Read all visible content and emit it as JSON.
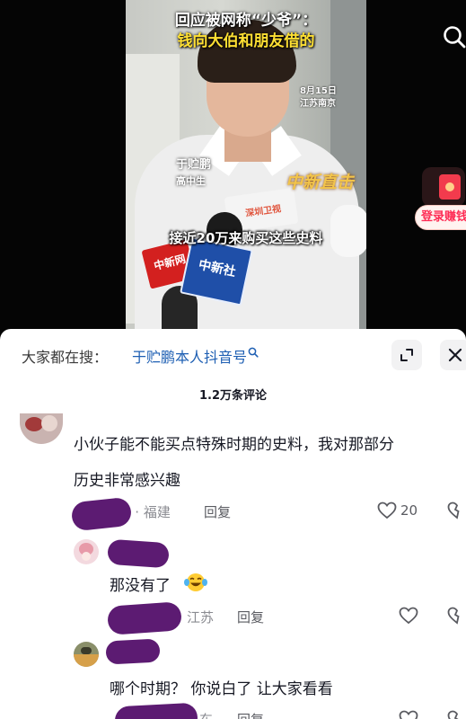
{
  "video": {
    "title_line1": "回应被网称“少爷”：",
    "title_line2": "钱向大伯和朋友借的",
    "date": "8月15日",
    "location": "江苏南京",
    "person_name": "于贮鹏",
    "person_role": "高中生",
    "brand_watermark": "中新直击",
    "subtitle": "接近20万来购买这些史料",
    "mic_red_text": "中新网",
    "mic_blue_text": "中新社",
    "mic_white_text": "深圳卫视"
  },
  "promo": {
    "label": "登录赚钱"
  },
  "comments_panel": {
    "search_prefix": "大家都在搜：",
    "search_term": "于贮鹏本人抖音号",
    "comment_count": "1.2万条评论"
  },
  "comments": [
    {
      "text_line1": "小伙子能不能买点特殊时期的史料，我对那部分",
      "text_line2": "历史非常感兴趣",
      "meta": "1天前 · 福建",
      "reply_label": "回复",
      "likes": "20"
    },
    {
      "text": "那没有了",
      "emoji": "laughing-tears",
      "meta": "江苏",
      "reply_label": "回复"
    },
    {
      "text": "哪个时期？   你说白了  让大家看看",
      "meta": "东",
      "reply_label": "回复"
    }
  ]
}
